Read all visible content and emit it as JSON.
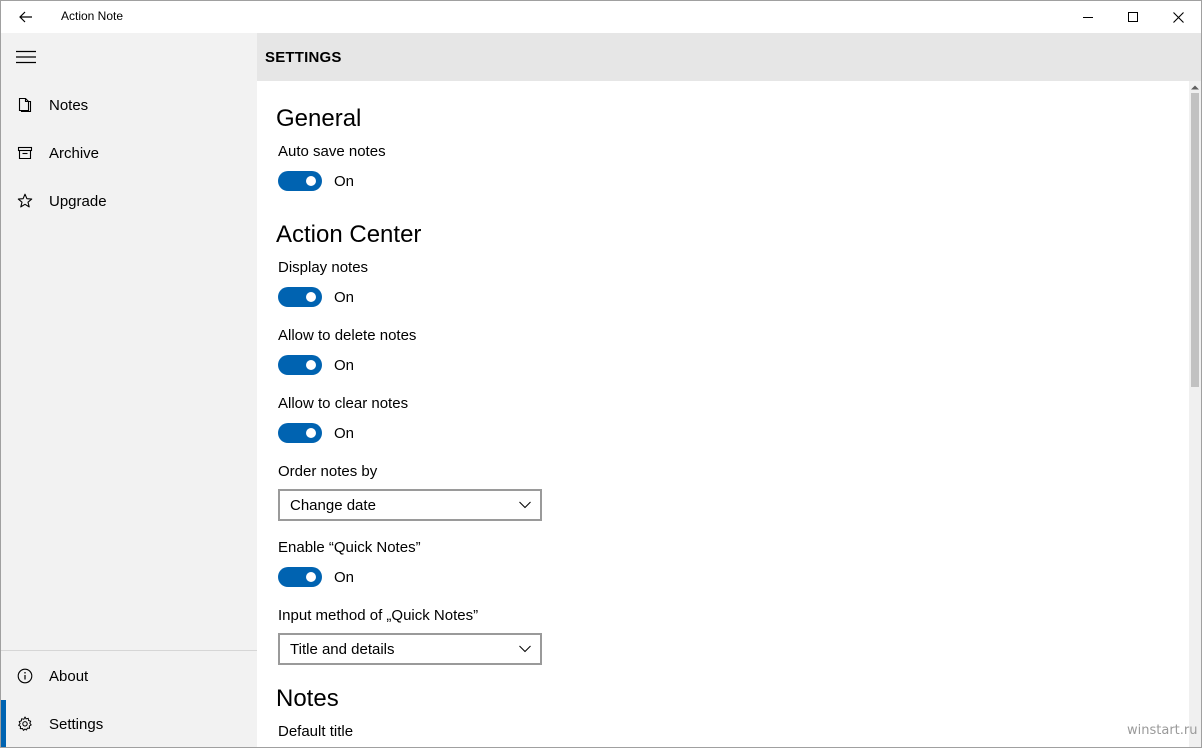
{
  "titlebar": {
    "title": "Action Note",
    "back_icon": "back-arrow-icon",
    "minimize_icon": "minimize-icon",
    "maximize_icon": "maximize-icon",
    "close_icon": "close-icon"
  },
  "sidebar": {
    "menu_icon": "hamburger-icon",
    "top_items": [
      {
        "label": "Notes",
        "icon": "notes-icon"
      },
      {
        "label": "Archive",
        "icon": "archive-icon"
      },
      {
        "label": "Upgrade",
        "icon": "star-icon"
      }
    ],
    "bottom_items": [
      {
        "label": "About",
        "icon": "info-icon"
      },
      {
        "label": "Settings",
        "icon": "gear-icon",
        "selected": true
      }
    ],
    "accent_color": "#0063b1"
  },
  "header": {
    "title": "SETTINGS"
  },
  "settings": {
    "general": {
      "title": "General",
      "auto_save_label": "Auto save notes",
      "auto_save_state": "On"
    },
    "action_center": {
      "title": "Action Center",
      "display_notes_label": "Display notes",
      "display_notes_state": "On",
      "allow_delete_label": "Allow to delete notes",
      "allow_delete_state": "On",
      "allow_clear_label": "Allow to clear notes",
      "allow_clear_state": "On",
      "order_by_label": "Order notes by",
      "order_by_value": "Change date",
      "quick_notes_label": "Enable “Quick Notes”",
      "quick_notes_state": "On",
      "input_method_label": "Input method of „Quick Notes”",
      "input_method_value": "Title and details"
    },
    "notes": {
      "title": "Notes",
      "default_title_label": "Default title"
    }
  },
  "watermark": "winstart.ru",
  "colors": {
    "toggle_on": "#0063b1",
    "header_bg": "#e6e6e6",
    "sidebar_bg": "#f2f2f2"
  }
}
